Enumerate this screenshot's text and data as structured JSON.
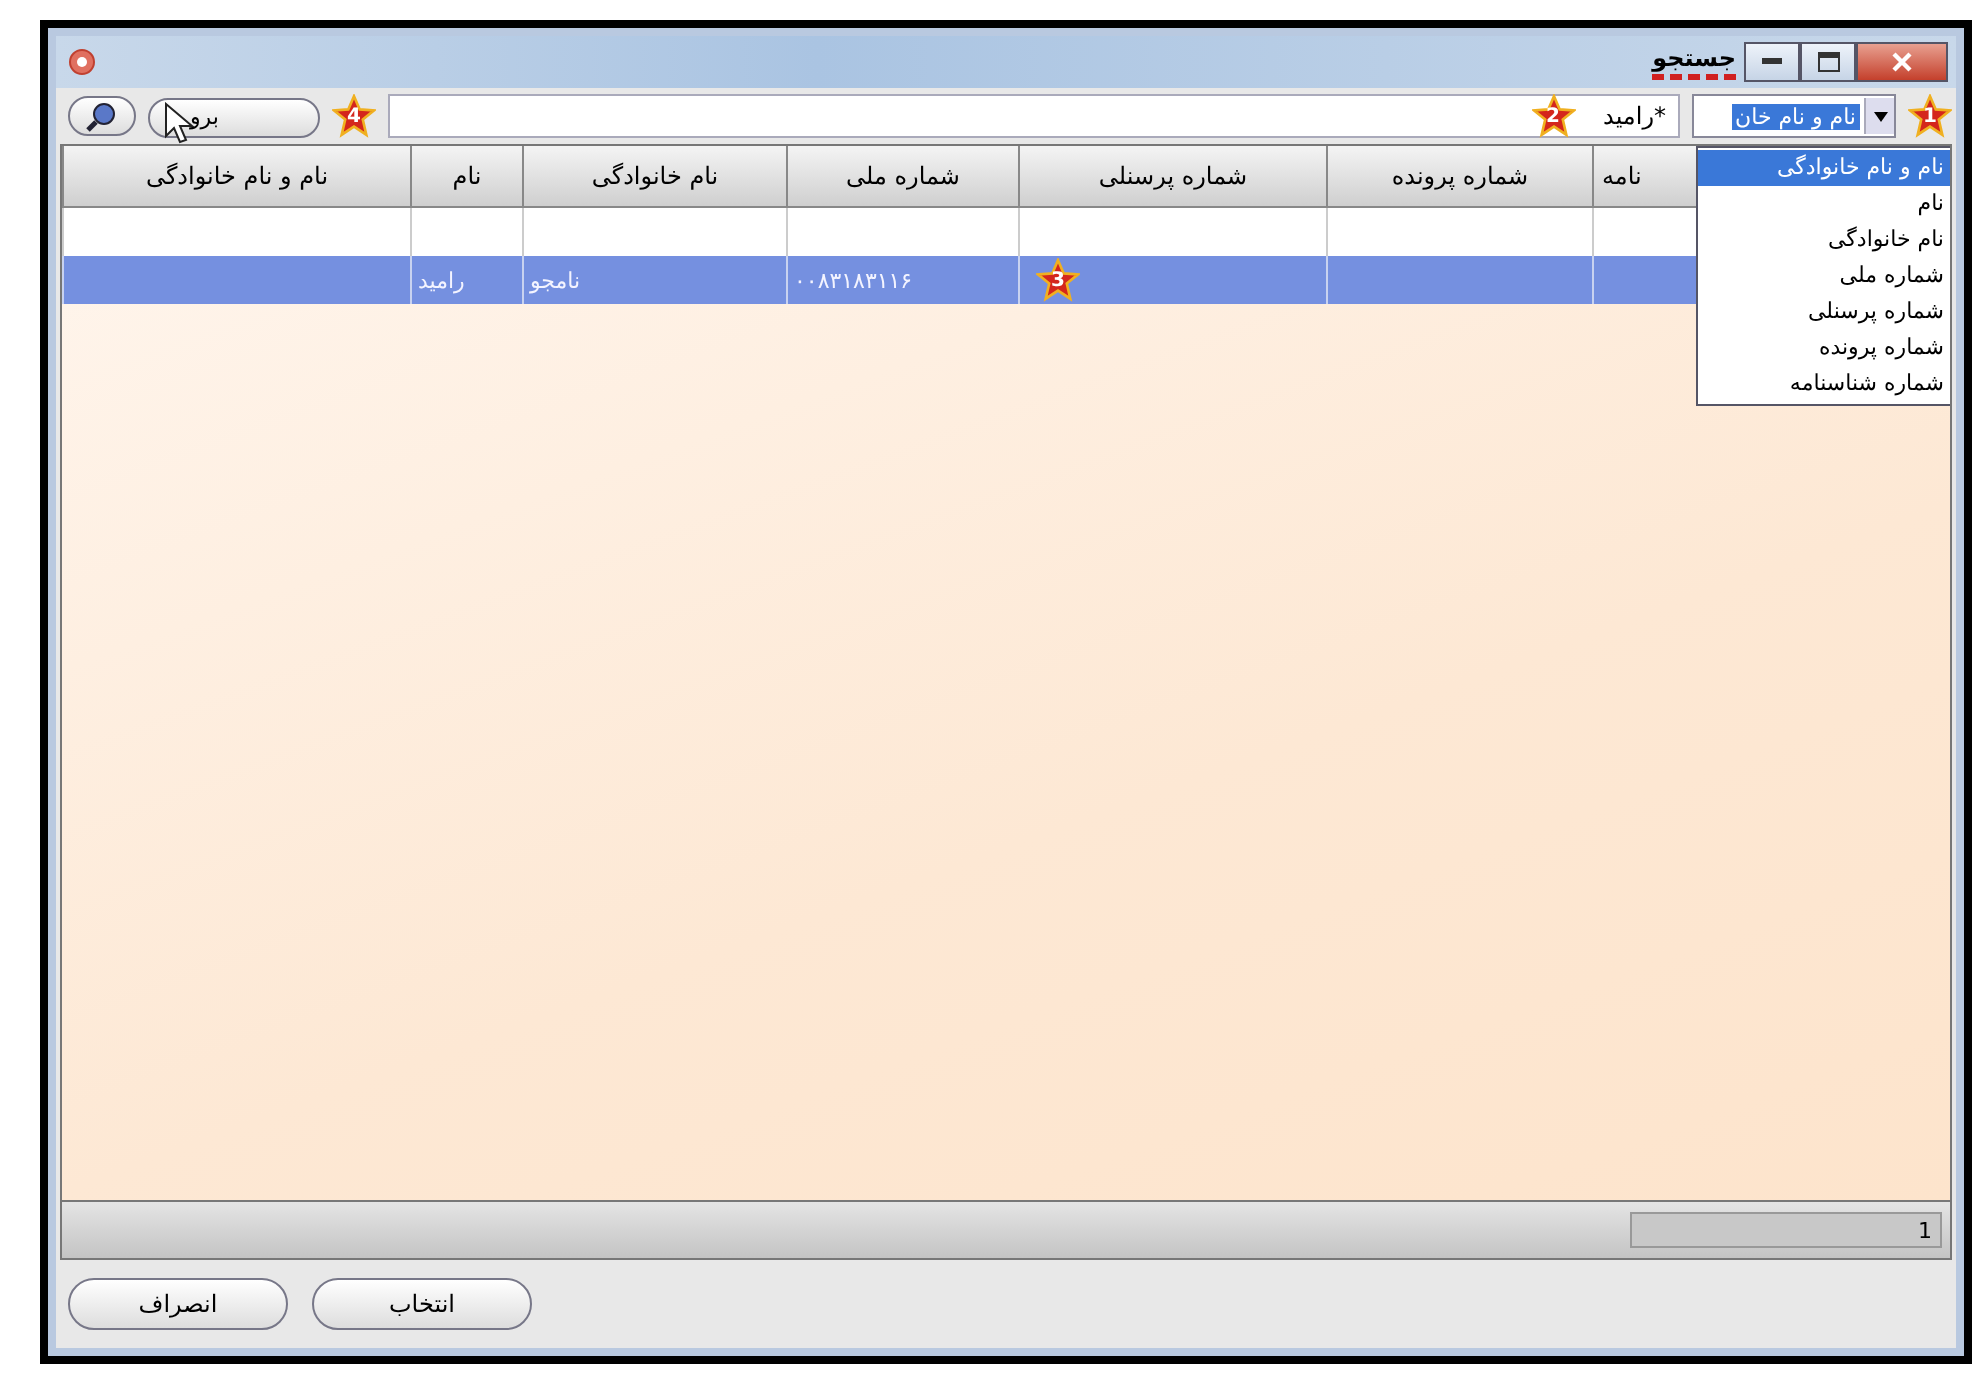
{
  "window": {
    "title": "جستجو"
  },
  "search_bar": {
    "field_combo": {
      "value": "نام و نام خان",
      "marker": "1"
    },
    "field_options": [
      {
        "label": "نام و نام خانوادگی",
        "selected": true
      },
      {
        "label": "نام",
        "selected": false
      },
      {
        "label": "نام خانوادگی",
        "selected": false
      },
      {
        "label": "شماره ملی",
        "selected": false
      },
      {
        "label": "شماره پرسنلی",
        "selected": false
      },
      {
        "label": "شماره پرونده",
        "selected": false
      },
      {
        "label": "شماره شناسنامه",
        "selected": false
      }
    ],
    "query": {
      "value": "*رامید",
      "marker": "2"
    },
    "go_button": {
      "label": "برو",
      "marker": "4"
    }
  },
  "table": {
    "columns": [
      "نامه",
      "شماره پرونده",
      "شماره پرسنلی",
      "شماره ملی",
      "نام خانوادگی",
      "نام",
      "نام و نام خانوادگی"
    ],
    "rows": [
      {
        "selected": false,
        "cells": [
          null,
          null,
          null,
          null,
          null,
          null,
          null
        ]
      },
      {
        "selected": true,
        "marker": "3",
        "cells": [
          null,
          null,
          null,
          "۰۰۸۳۱۸۳۱۱۶",
          "نامجو",
          "رامید",
          null
        ]
      }
    ]
  },
  "status_bar": {
    "count": "1"
  },
  "buttons": [
    {
      "label": "انتخاب"
    },
    {
      "label": "انصراف"
    }
  ]
}
